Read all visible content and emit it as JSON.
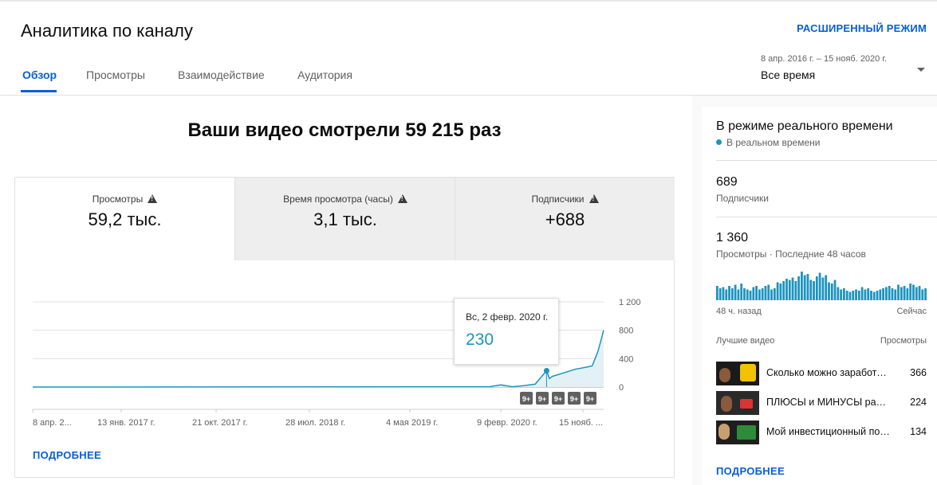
{
  "header": {
    "title": "Аналитика по каналу",
    "advanced_mode": "РАСШИРЕННЫЙ РЕЖИМ",
    "tabs": [
      {
        "label": "Обзор",
        "active": true
      },
      {
        "label": "Просмотры",
        "active": false
      },
      {
        "label": "Взаимодействие",
        "active": false
      },
      {
        "label": "Аудитория",
        "active": false
      }
    ],
    "date_range": {
      "dates": "8 апр. 2016 г. – 15 нояб. 2020 г.",
      "label": "Все время"
    }
  },
  "main": {
    "headline": "Ваши видео смотрели 59 215 раз",
    "metric_tabs": [
      {
        "label": "Просмотры",
        "value": "59,2 тыс.",
        "selected": true
      },
      {
        "label": "Время просмотра (часы)",
        "value": "3,1 тыс.",
        "selected": false
      },
      {
        "label": "Подписчики",
        "value": "+688",
        "selected": false
      }
    ],
    "more": "ПОДРОБНЕЕ",
    "tooltip": {
      "date": "Вс, 2 февр. 2020 г.",
      "value": "230"
    }
  },
  "chart_data": {
    "type": "area",
    "x_ticks": [
      "8 апр. 2...",
      "13 янв. 2017 г.",
      "21 окт. 2017 г.",
      "28 июл. 2018 г.",
      "4 мая 2019 г.",
      "9 февр. 2020 г.",
      "15 нояб. ..."
    ],
    "y_ticks": [
      "1 200",
      "800",
      "400",
      "0"
    ],
    "ylim": [
      0,
      1200
    ],
    "series": [
      {
        "x": [
          0,
          0.8,
          0.82,
          0.84,
          0.86,
          0.88,
          0.9,
          0.905,
          0.91,
          0.93,
          0.95,
          0.97,
          0.98,
          0.99,
          1.0
        ],
        "values": [
          0,
          5,
          30,
          5,
          20,
          40,
          230,
          120,
          150,
          200,
          250,
          280,
          300,
          500,
          800
        ]
      }
    ],
    "markers": [
      "9+",
      "9+",
      "9+",
      "9+",
      "9+"
    ],
    "color": "#1c94bf"
  },
  "realtime": {
    "title": "В режиме реального времени",
    "live_label": "В реальном времени",
    "subscribers_value": "689",
    "subscribers_label": "Подписчики",
    "views_value": "1 360",
    "views_label": "Просмотры · Последние 48 часов",
    "bars": [
      12,
      10,
      11,
      9,
      12,
      10,
      13,
      9,
      14,
      10,
      9,
      8,
      11,
      12,
      9,
      10,
      12,
      13,
      9,
      10,
      15,
      14,
      16,
      18,
      17,
      19,
      16,
      20,
      24,
      21,
      22,
      17,
      16,
      20,
      23,
      19,
      21,
      15,
      14,
      17,
      11,
      9,
      10,
      8,
      7,
      8,
      9,
      8,
      11,
      9,
      10,
      8,
      7,
      8,
      9,
      10,
      11,
      12,
      10,
      9,
      13,
      11,
      12,
      10,
      14,
      13,
      11,
      12,
      9,
      10
    ],
    "axis_left": "48 ч. назад",
    "axis_right": "Сейчас",
    "col_video": "Лучшие видео",
    "col_views": "Просмотры",
    "videos": [
      {
        "title": "Сколько можно заработать",
        "views": "366"
      },
      {
        "title": "ПЛЮСЫ и МИНУСЫ работы",
        "views": "224"
      },
      {
        "title": "Мой инвестиционный портфель",
        "views": "134"
      }
    ],
    "more": "ПОДРОБНЕЕ"
  }
}
